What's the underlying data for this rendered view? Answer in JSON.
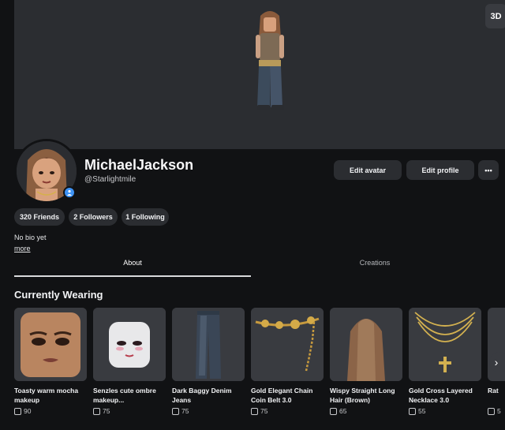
{
  "banner": {
    "view_3d_label": "3D"
  },
  "profile": {
    "display_name": "MichaelJackson",
    "username": "@Starlightmile",
    "bio": "No bio yet",
    "more_label": "more"
  },
  "actions": {
    "edit_avatar": "Edit avatar",
    "edit_profile": "Edit profile",
    "more": "•••"
  },
  "stats": {
    "friends": "320 Friends",
    "followers": "2 Followers",
    "following": "1 Following"
  },
  "tabs": [
    {
      "label": "About",
      "active": true
    },
    {
      "label": "Creations",
      "active": false
    }
  ],
  "section": {
    "title": "Currently Wearing"
  },
  "items": [
    {
      "name": "Toasty warm mocha makeup",
      "price": "90"
    },
    {
      "name": "Senzles cute ombre makeup...",
      "price": "75"
    },
    {
      "name": "Dark Baggy Denim Jeans",
      "price": "75"
    },
    {
      "name": "Gold Elegant Chain Coin Belt 3.0",
      "price": "75"
    },
    {
      "name": "Wispy Straight Long Hair (Brown)",
      "price": "65"
    },
    {
      "name": "Gold Cross Layered Necklace 3.0",
      "price": "55"
    },
    {
      "name": "Rat",
      "price": "5"
    }
  ],
  "icons": {
    "online": "person-icon",
    "currency": "robux-icon",
    "scroll": "chevron-right-icon"
  },
  "colors": {
    "background": "#111214",
    "surface": "#2b2d31",
    "accent_blue": "#3e93f5"
  }
}
